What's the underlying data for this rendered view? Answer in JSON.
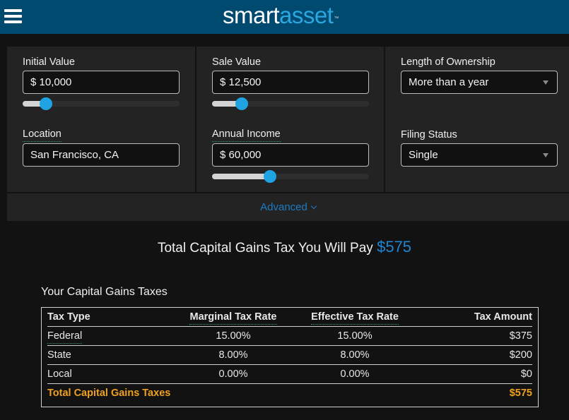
{
  "header": {
    "menu_icon": "hamburger-menu-icon",
    "logo_part1": "smart",
    "logo_part2": "asset",
    "logo_tm": "™",
    "brand_color": "#004a70",
    "accent_color": "#2aa6e0"
  },
  "form": {
    "initial_value": {
      "label": "Initial Value",
      "value": "$ 10,000",
      "slider_percent": 15
    },
    "sale_value": {
      "label": "Sale Value",
      "value": "$ 12,500",
      "slider_percent": 19
    },
    "length_of_ownership": {
      "label": "Length of Ownership",
      "selected": "More than a year"
    },
    "location": {
      "label": "Location",
      "value": "San Francisco, CA"
    },
    "annual_income": {
      "label": "Annual Income",
      "value": "$ 60,000",
      "slider_percent": 37
    },
    "filing_status": {
      "label": "Filing Status",
      "selected": "Single"
    },
    "advanced_label": "Advanced"
  },
  "result": {
    "text": "Total Capital Gains Tax You Will Pay",
    "amount": "$575"
  },
  "taxes": {
    "title": "Your Capital Gains Taxes",
    "columns": [
      "Tax Type",
      "Marginal Tax Rate",
      "Effective Tax Rate",
      "Tax Amount"
    ],
    "rows": [
      {
        "type": "Federal",
        "marginal": "15.00%",
        "effective": "15.00%",
        "amount": "$375"
      },
      {
        "type": "State",
        "marginal": "8.00%",
        "effective": "8.00%",
        "amount": "$200"
      },
      {
        "type": "Local",
        "marginal": "0.00%",
        "effective": "0.00%",
        "amount": "$0"
      }
    ],
    "total": {
      "label": "Total Capital Gains Taxes",
      "amount": "$575",
      "color": "#f0a020"
    }
  }
}
